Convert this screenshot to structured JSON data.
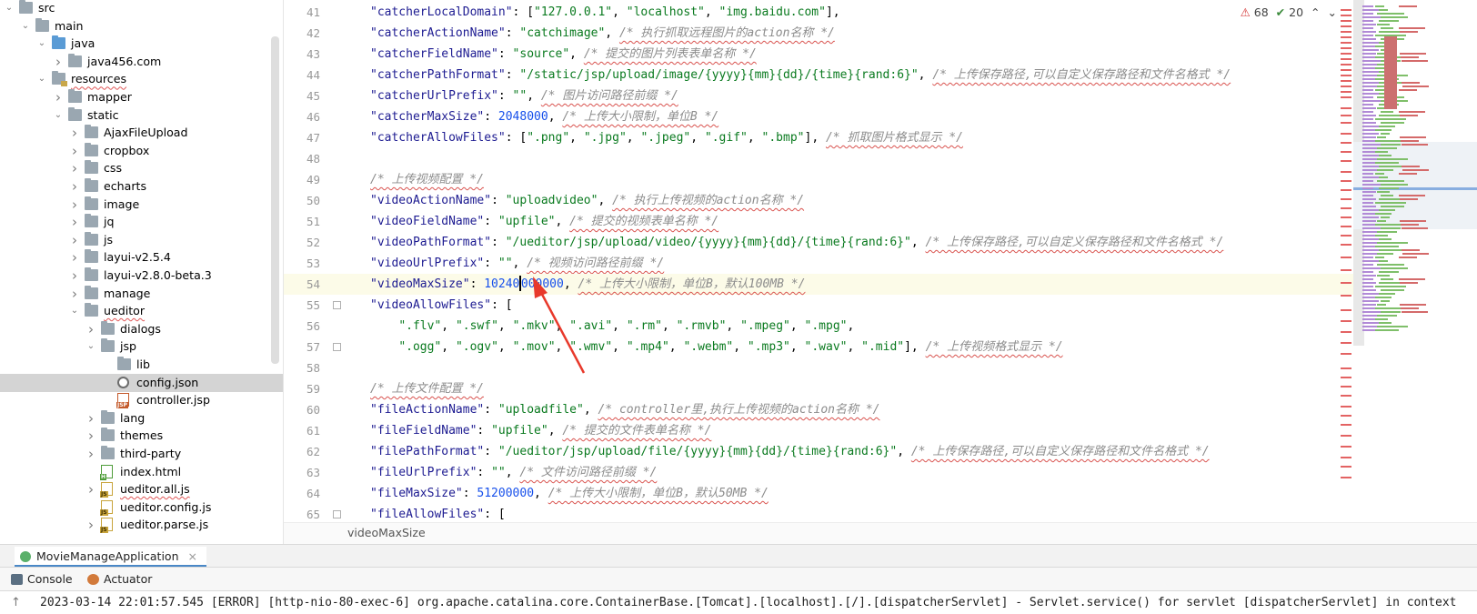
{
  "tree": {
    "items": [
      {
        "label": "src",
        "depth": 0,
        "chev": "v",
        "icon": "folder",
        "underline": false,
        "selected": false
      },
      {
        "label": "main",
        "depth": 1,
        "chev": "v",
        "icon": "folder",
        "underline": false,
        "selected": false
      },
      {
        "label": "java",
        "depth": 2,
        "chev": "v",
        "icon": "folder-java",
        "underline": false,
        "selected": false
      },
      {
        "label": "java456.com",
        "depth": 3,
        "chev": ">",
        "icon": "package",
        "underline": false,
        "selected": false
      },
      {
        "label": "resources",
        "depth": 2,
        "chev": "v",
        "icon": "folder-res",
        "underline": true,
        "selected": false
      },
      {
        "label": "mapper",
        "depth": 3,
        "chev": ">",
        "icon": "folder",
        "underline": false,
        "selected": false
      },
      {
        "label": "static",
        "depth": 3,
        "chev": "v",
        "icon": "folder",
        "underline": false,
        "selected": false
      },
      {
        "label": "AjaxFileUpload",
        "depth": 4,
        "chev": ">",
        "icon": "folder",
        "underline": false,
        "selected": false
      },
      {
        "label": "cropbox",
        "depth": 4,
        "chev": ">",
        "icon": "folder",
        "underline": false,
        "selected": false
      },
      {
        "label": "css",
        "depth": 4,
        "chev": ">",
        "icon": "folder",
        "underline": false,
        "selected": false
      },
      {
        "label": "echarts",
        "depth": 4,
        "chev": ">",
        "icon": "folder",
        "underline": false,
        "selected": false
      },
      {
        "label": "image",
        "depth": 4,
        "chev": ">",
        "icon": "folder",
        "underline": false,
        "selected": false
      },
      {
        "label": "jq",
        "depth": 4,
        "chev": ">",
        "icon": "folder",
        "underline": false,
        "selected": false
      },
      {
        "label": "js",
        "depth": 4,
        "chev": ">",
        "icon": "folder",
        "underline": false,
        "selected": false
      },
      {
        "label": "layui-v2.5.4",
        "depth": 4,
        "chev": ">",
        "icon": "folder",
        "underline": false,
        "selected": false
      },
      {
        "label": "layui-v2.8.0-beta.3",
        "depth": 4,
        "chev": ">",
        "icon": "folder",
        "underline": false,
        "selected": false
      },
      {
        "label": "manage",
        "depth": 4,
        "chev": ">",
        "icon": "folder",
        "underline": false,
        "selected": false
      },
      {
        "label": "ueditor",
        "depth": 4,
        "chev": "v",
        "icon": "folder",
        "underline": true,
        "selected": false
      },
      {
        "label": "dialogs",
        "depth": 5,
        "chev": ">",
        "icon": "folder",
        "underline": false,
        "selected": false
      },
      {
        "label": "jsp",
        "depth": 5,
        "chev": "v",
        "icon": "folder",
        "underline": false,
        "selected": false
      },
      {
        "label": "lib",
        "depth": 6,
        "chev": "",
        "icon": "folder",
        "underline": false,
        "selected": false
      },
      {
        "label": "config.json",
        "depth": 6,
        "chev": "",
        "icon": "json",
        "underline": false,
        "selected": true
      },
      {
        "label": "controller.jsp",
        "depth": 6,
        "chev": "",
        "icon": "jsp",
        "underline": false,
        "selected": false
      },
      {
        "label": "lang",
        "depth": 5,
        "chev": ">",
        "icon": "folder",
        "underline": false,
        "selected": false
      },
      {
        "label": "themes",
        "depth": 5,
        "chev": ">",
        "icon": "folder",
        "underline": false,
        "selected": false
      },
      {
        "label": "third-party",
        "depth": 5,
        "chev": ">",
        "icon": "folder",
        "underline": false,
        "selected": false
      },
      {
        "label": "index.html",
        "depth": 5,
        "chev": "",
        "icon": "html",
        "underline": false,
        "selected": false
      },
      {
        "label": "ueditor.all.js",
        "depth": 5,
        "chev": ">",
        "icon": "js",
        "underline": true,
        "selected": false
      },
      {
        "label": "ueditor.config.js",
        "depth": 5,
        "chev": "",
        "icon": "js",
        "underline": false,
        "selected": false
      },
      {
        "label": "ueditor.parse.js",
        "depth": 5,
        "chev": ">",
        "icon": "js",
        "underline": false,
        "selected": false
      }
    ]
  },
  "inspections": {
    "errors": "68",
    "checks": "20"
  },
  "editor": {
    "lines": [
      {
        "no": "41",
        "tokens": [
          [
            "k",
            "\"catcherLocalDomain\""
          ],
          [
            "p",
            ": ["
          ],
          [
            "s",
            "\"127.0.0.1\""
          ],
          [
            "p",
            ", "
          ],
          [
            "s",
            "\"localhost\""
          ],
          [
            "p",
            ", "
          ],
          [
            "s",
            "\"img.baidu.com\""
          ],
          [
            "p",
            "],"
          ]
        ]
      },
      {
        "no": "42",
        "tokens": [
          [
            "k",
            "\"catcherActionName\""
          ],
          [
            "p",
            ": "
          ],
          [
            "s",
            "\"catchimage\""
          ],
          [
            "p",
            ", "
          ],
          [
            "c",
            "/* 执行抓取远程图片的action名称 */"
          ]
        ]
      },
      {
        "no": "43",
        "tokens": [
          [
            "k",
            "\"catcherFieldName\""
          ],
          [
            "p",
            ": "
          ],
          [
            "s",
            "\"source\""
          ],
          [
            "p",
            ", "
          ],
          [
            "c",
            "/* 提交的图片列表表单名称 */"
          ]
        ]
      },
      {
        "no": "44",
        "tokens": [
          [
            "k",
            "\"catcherPathFormat\""
          ],
          [
            "p",
            ": "
          ],
          [
            "s",
            "\"/static/jsp/upload/image/{yyyy}{mm}{dd}/{time}{rand:6}\""
          ],
          [
            "p",
            ", "
          ],
          [
            "c",
            "/* 上传保存路径,可以自定义保存路径和文件名格式 */"
          ]
        ]
      },
      {
        "no": "45",
        "tokens": [
          [
            "k",
            "\"catcherUrlPrefix\""
          ],
          [
            "p",
            ": "
          ],
          [
            "s",
            "\"\""
          ],
          [
            "p",
            ", "
          ],
          [
            "c",
            "/* 图片访问路径前缀 */"
          ]
        ]
      },
      {
        "no": "46",
        "tokens": [
          [
            "k",
            "\"catcherMaxSize\""
          ],
          [
            "p",
            ": "
          ],
          [
            "n",
            "2048000"
          ],
          [
            "p",
            ", "
          ],
          [
            "c",
            "/* 上传大小限制，单位B */"
          ]
        ]
      },
      {
        "no": "47",
        "tokens": [
          [
            "k",
            "\"catcherAllowFiles\""
          ],
          [
            "p",
            ": ["
          ],
          [
            "s",
            "\".png\""
          ],
          [
            "p",
            ", "
          ],
          [
            "s",
            "\".jpg\""
          ],
          [
            "p",
            ", "
          ],
          [
            "s",
            "\".jpeg\""
          ],
          [
            "p",
            ", "
          ],
          [
            "s",
            "\".gif\""
          ],
          [
            "p",
            ", "
          ],
          [
            "s",
            "\".bmp\""
          ],
          [
            "p",
            "], "
          ],
          [
            "c",
            "/* 抓取图片格式显示 */"
          ]
        ]
      },
      {
        "no": "48",
        "tokens": []
      },
      {
        "no": "49",
        "tokens": [
          [
            "c",
            "/* 上传视频配置 */"
          ]
        ]
      },
      {
        "no": "50",
        "tokens": [
          [
            "k",
            "\"videoActionName\""
          ],
          [
            "p",
            ": "
          ],
          [
            "s",
            "\"uploadvideo\""
          ],
          [
            "p",
            ", "
          ],
          [
            "c",
            "/* 执行上传视频的action名称 */"
          ]
        ]
      },
      {
        "no": "51",
        "tokens": [
          [
            "k",
            "\"videoFieldName\""
          ],
          [
            "p",
            ": "
          ],
          [
            "s",
            "\"upfile\""
          ],
          [
            "p",
            ", "
          ],
          [
            "c",
            "/* 提交的视频表单名称 */"
          ]
        ]
      },
      {
        "no": "52",
        "tokens": [
          [
            "k",
            "\"videoPathFormat\""
          ],
          [
            "p",
            ": "
          ],
          [
            "s",
            "\"/ueditor/jsp/upload/video/{yyyy}{mm}{dd}/{time}{rand:6}\""
          ],
          [
            "p",
            ", "
          ],
          [
            "c",
            "/* 上传保存路径,可以自定义保存路径和文件名格式 */"
          ]
        ]
      },
      {
        "no": "53",
        "tokens": [
          [
            "k",
            "\"videoUrlPrefix\""
          ],
          [
            "p",
            ": "
          ],
          [
            "s",
            "\"\""
          ],
          [
            "p",
            ", "
          ],
          [
            "c",
            "/* 视频访问路径前缀 */"
          ]
        ]
      },
      {
        "no": "54",
        "tokens": [
          [
            "k",
            "\"videoMaxSize\""
          ],
          [
            "p",
            ": "
          ],
          [
            "n",
            "10240000000"
          ],
          [
            "p",
            ", "
          ],
          [
            "c",
            "/* 上传大小限制，单位B，默认100MB */"
          ]
        ]
      },
      {
        "no": "55",
        "tokens": [
          [
            "k",
            "\"videoAllowFiles\""
          ],
          [
            "p",
            ": ["
          ]
        ]
      },
      {
        "no": "56",
        "tokens": [
          [
            "p",
            "    "
          ],
          [
            "s",
            "\".flv\""
          ],
          [
            "p",
            ", "
          ],
          [
            "s",
            "\".swf\""
          ],
          [
            "p",
            ", "
          ],
          [
            "s",
            "\".mkv\""
          ],
          [
            "p",
            ", "
          ],
          [
            "s",
            "\".avi\""
          ],
          [
            "p",
            ", "
          ],
          [
            "s",
            "\".rm\""
          ],
          [
            "p",
            ", "
          ],
          [
            "s",
            "\".rmvb\""
          ],
          [
            "p",
            ", "
          ],
          [
            "s",
            "\".mpeg\""
          ],
          [
            "p",
            ", "
          ],
          [
            "s",
            "\".mpg\""
          ],
          [
            "p",
            ","
          ]
        ]
      },
      {
        "no": "57",
        "tokens": [
          [
            "p",
            "    "
          ],
          [
            "s",
            "\".ogg\""
          ],
          [
            "p",
            ", "
          ],
          [
            "s",
            "\".ogv\""
          ],
          [
            "p",
            ", "
          ],
          [
            "s",
            "\".mov\""
          ],
          [
            "p",
            ", "
          ],
          [
            "s",
            "\".wmv\""
          ],
          [
            "p",
            ", "
          ],
          [
            "s",
            "\".mp4\""
          ],
          [
            "p",
            ", "
          ],
          [
            "s",
            "\".webm\""
          ],
          [
            "p",
            ", "
          ],
          [
            "s",
            "\".mp3\""
          ],
          [
            "p",
            ", "
          ],
          [
            "s",
            "\".wav\""
          ],
          [
            "p",
            ", "
          ],
          [
            "s",
            "\".mid\""
          ],
          [
            "p",
            "], "
          ],
          [
            "c",
            "/* 上传视频格式显示 */"
          ]
        ]
      },
      {
        "no": "58",
        "tokens": []
      },
      {
        "no": "59",
        "tokens": [
          [
            "c",
            "/* 上传文件配置 */"
          ]
        ]
      },
      {
        "no": "60",
        "tokens": [
          [
            "k",
            "\"fileActionName\""
          ],
          [
            "p",
            ": "
          ],
          [
            "s",
            "\"uploadfile\""
          ],
          [
            "p",
            ", "
          ],
          [
            "c",
            "/* controller里,执行上传视频的action名称 */"
          ]
        ]
      },
      {
        "no": "61",
        "tokens": [
          [
            "k",
            "\"fileFieldName\""
          ],
          [
            "p",
            ": "
          ],
          [
            "s",
            "\"upfile\""
          ],
          [
            "p",
            ", "
          ],
          [
            "c",
            "/* 提交的文件表单名称 */"
          ]
        ]
      },
      {
        "no": "62",
        "tokens": [
          [
            "k",
            "\"filePathFormat\""
          ],
          [
            "p",
            ": "
          ],
          [
            "s",
            "\"/ueditor/jsp/upload/file/{yyyy}{mm}{dd}/{time}{rand:6}\""
          ],
          [
            "p",
            ", "
          ],
          [
            "c",
            "/* 上传保存路径,可以自定义保存路径和文件名格式 */"
          ]
        ]
      },
      {
        "no": "63",
        "tokens": [
          [
            "k",
            "\"fileUrlPrefix\""
          ],
          [
            "p",
            ": "
          ],
          [
            "s",
            "\"\""
          ],
          [
            "p",
            ", "
          ],
          [
            "c",
            "/* 文件访问路径前缀 */"
          ]
        ]
      },
      {
        "no": "64",
        "tokens": [
          [
            "k",
            "\"fileMaxSize\""
          ],
          [
            "p",
            ": "
          ],
          [
            "n",
            "51200000"
          ],
          [
            "p",
            ", "
          ],
          [
            "c",
            "/* 上传大小限制，单位B，默认50MB */"
          ]
        ]
      },
      {
        "no": "65",
        "tokens": [
          [
            "k",
            "\"fileAllowFiles\""
          ],
          [
            "p",
            ": ["
          ]
        ]
      }
    ],
    "current_line": "54"
  },
  "breadcrumb": "videoMaxSize",
  "run": {
    "tab_label": "MovieManageApplication"
  },
  "tools": {
    "console": "Console",
    "actuator": "Actuator"
  },
  "console_line": "2023-03-14 22:01:57.545 [ERROR] [http-nio-80-exec-6] org.apache.catalina.core.ContainerBase.[Tomcat].[localhost].[/].[dispatcherServlet] - Servlet.service() for servlet [dispatcherServlet] in context"
}
